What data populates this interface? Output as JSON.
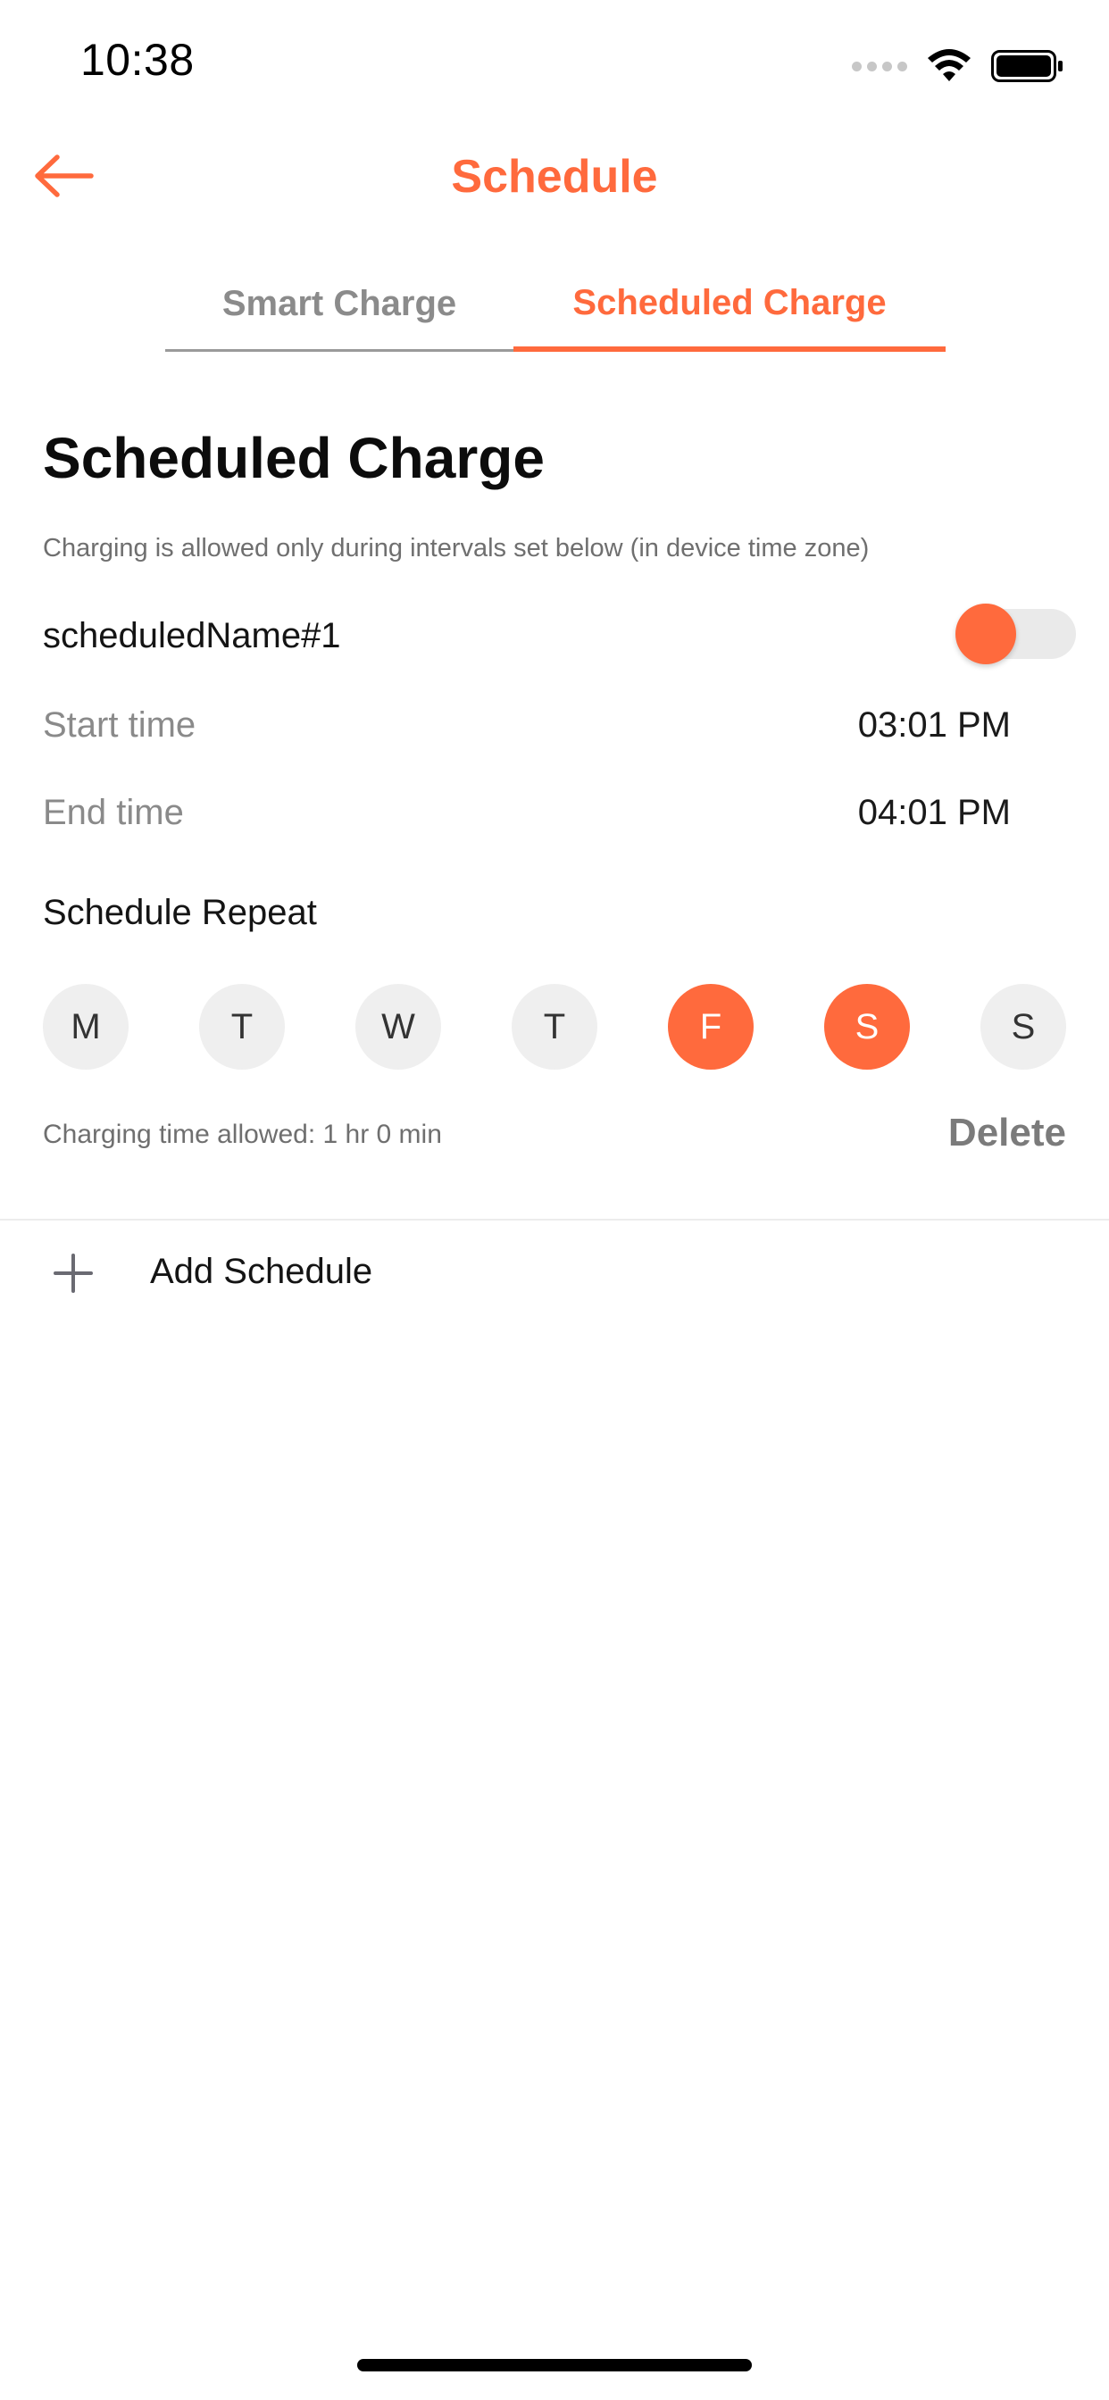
{
  "status_bar": {
    "time": "10:38"
  },
  "header": {
    "title": "Schedule"
  },
  "tabs": [
    {
      "label": "Smart Charge",
      "active": false
    },
    {
      "label": "Scheduled Charge",
      "active": true
    }
  ],
  "section": {
    "title": "Scheduled Charge",
    "subtitle": "Charging is allowed only during intervals set below (in device time zone)"
  },
  "schedule": {
    "name": "scheduledName#1",
    "enabled": true,
    "start_label": "Start time",
    "start_value": "03:01 PM",
    "end_label": "End time",
    "end_value": "04:01 PM",
    "repeat_label": "Schedule Repeat",
    "days": [
      {
        "label": "M",
        "selected": false
      },
      {
        "label": "T",
        "selected": false
      },
      {
        "label": "W",
        "selected": false
      },
      {
        "label": "T",
        "selected": false
      },
      {
        "label": "F",
        "selected": true
      },
      {
        "label": "S",
        "selected": true
      },
      {
        "label": "S",
        "selected": false
      }
    ],
    "allowed_text": "Charging time allowed: 1 hr 0 min",
    "delete_label": "Delete"
  },
  "add_schedule": {
    "label": "Add Schedule"
  },
  "colors": {
    "accent": "#ff6a3d",
    "inactive_tab": "#8b8b8b",
    "day_off_bg": "#efefef"
  }
}
